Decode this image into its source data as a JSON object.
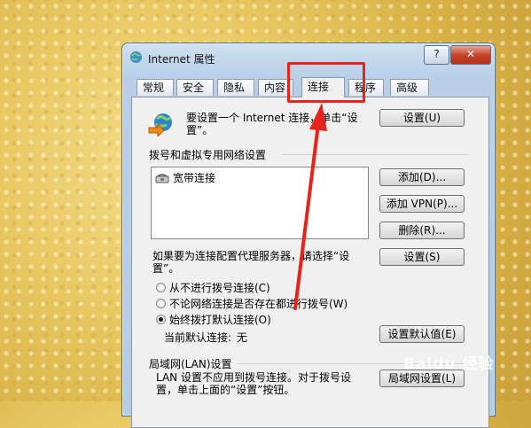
{
  "window": {
    "title": "Internet 属性",
    "help_label": "?",
    "close_label": "✕"
  },
  "tabs": [
    {
      "label": "常规"
    },
    {
      "label": "安全"
    },
    {
      "label": "隐私"
    },
    {
      "label": "内容"
    },
    {
      "label": "连接",
      "active": true
    },
    {
      "label": "程序"
    },
    {
      "label": "高级"
    }
  ],
  "intro": {
    "text": "要设置一个 Internet 连接，单击“设置”。",
    "setup_button": "设置(U)"
  },
  "dialup": {
    "section_title": "拨号和虚拟专用网络设置",
    "connections": [
      {
        "name": "宽带连接"
      }
    ],
    "add_button": "添加(D)...",
    "add_vpn_button": "添加 VPN(P)...",
    "remove_button": "删除(R)...",
    "proxy_text": "如果要为连接配置代理服务器，请选择“设置”。",
    "settings_button": "设置(S)"
  },
  "dial_options": [
    {
      "label": "从不进行拨号连接(C)",
      "selected": false
    },
    {
      "label": "不论网络连接是否存在都进行拨号(W)",
      "selected": false
    },
    {
      "label": "始终拨打默认连接(O)",
      "selected": true
    }
  ],
  "default_connection": {
    "label": "当前默认连接:",
    "value": "无",
    "set_default_button": "设置默认值(E)"
  },
  "lan": {
    "section_title": "局域网(LAN)设置",
    "text": "LAN 设置不应用到拨号连接。对于拨号设置，单击上面的“设置”按钮。",
    "lan_settings_button": "局域网设置(L)"
  },
  "watermark": "Baidu 经验",
  "annotation": {
    "highlight_color": "#e8231c"
  }
}
